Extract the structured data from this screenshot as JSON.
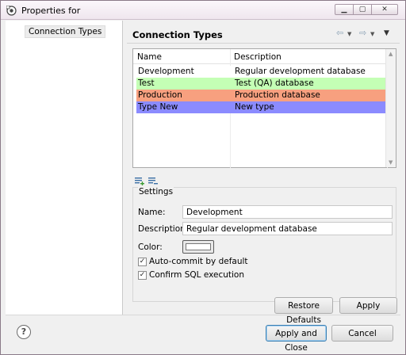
{
  "window": {
    "title": "Properties for",
    "buttons": {
      "minimize": "▁",
      "maximize": "▢",
      "close": "✕"
    }
  },
  "sidebar": {
    "items": [
      {
        "label": "Connection Types",
        "selected": true
      }
    ]
  },
  "page": {
    "title": "Connection Types",
    "nav_icons": [
      "back-arrow-icon",
      "forward-arrow-icon",
      "view-menu-icon"
    ]
  },
  "table": {
    "columns": [
      "Name",
      "Description"
    ],
    "rows": [
      {
        "name": "Development",
        "description": "Regular development database",
        "color": "#ffffff"
      },
      {
        "name": "Test",
        "description": "Test (QA) database",
        "color": "#c4ffb5"
      },
      {
        "name": "Production",
        "description": "Production database",
        "color": "#f7a07f"
      },
      {
        "name": "Type New",
        "description": "New type",
        "color": "#8b8bff"
      }
    ],
    "toolbar_icons": [
      "add-type-icon",
      "remove-type-icon"
    ]
  },
  "settings": {
    "legend": "Settings",
    "name_label": "Name:",
    "name_value": "Development",
    "description_label": "Description:",
    "description_value": "Regular development database",
    "color_label": "Color:",
    "color_value": "#ffffff",
    "auto_commit_label": "Auto-commit by default",
    "auto_commit_checked": true,
    "confirm_sql_label": "Confirm SQL execution",
    "confirm_sql_checked": true
  },
  "buttons": {
    "restore_defaults": "Restore Defaults",
    "apply": "Apply",
    "apply_and_close": "Apply and Close",
    "cancel": "Cancel",
    "help": "?"
  }
}
